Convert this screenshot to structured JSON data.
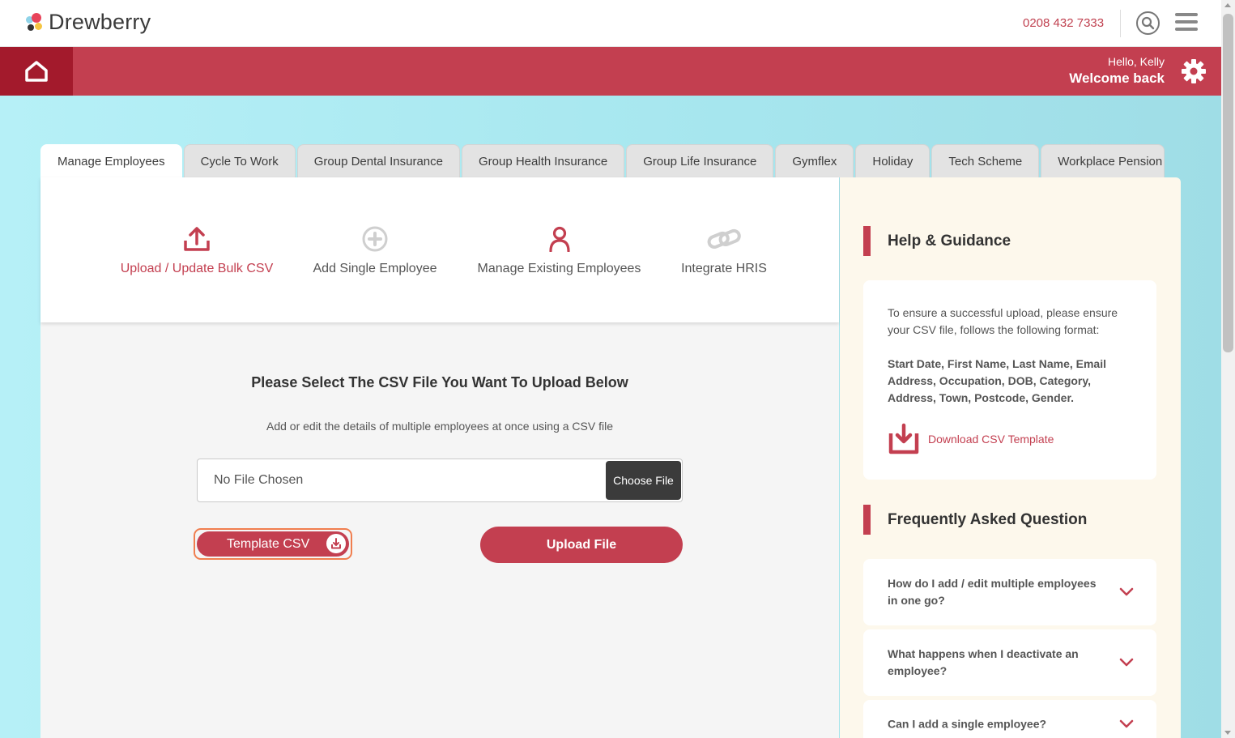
{
  "header": {
    "logo_text": "Drewberry",
    "phone": "0208 432 7333"
  },
  "welcome": {
    "hello": "Hello, Kelly",
    "welcome_back": "Welcome back"
  },
  "tabs": [
    {
      "label": "Manage Employees",
      "active": true
    },
    {
      "label": "Cycle To Work"
    },
    {
      "label": "Group Dental Insurance"
    },
    {
      "label": "Group Health Insurance"
    },
    {
      "label": "Group Life Insurance"
    },
    {
      "label": "Gymflex"
    },
    {
      "label": "Holiday"
    },
    {
      "label": "Tech Scheme"
    },
    {
      "label": "Workplace Pension"
    }
  ],
  "options": [
    {
      "label": "Upload / Update Bulk CSV",
      "icon": "upload-icon",
      "active": true
    },
    {
      "label": "Add Single Employee",
      "icon": "plus-circle-icon"
    },
    {
      "label": "Manage Existing Employees",
      "icon": "person-icon"
    },
    {
      "label": "Integrate HRIS",
      "icon": "link-icon"
    }
  ],
  "upload": {
    "title": "Please Select The CSV File You Want To Upload Below",
    "subtitle": "Add or edit the details of multiple employees at once using a CSV file",
    "file_label": "No File Chosen",
    "choose_button": "Choose File",
    "template_button": "Template CSV",
    "upload_button": "Upload File"
  },
  "help": {
    "title": "Help & Guidance",
    "text": "To ensure a successful upload, please ensure your CSV file, follows the following format:",
    "format": "Start Date, First Name, Last Name, Email Address, Occupation, DOB, Category, Address, Town, Postcode, Gender.",
    "download_label": "Download CSV Template"
  },
  "faq": {
    "title": "Frequently Asked Question",
    "items": [
      "How do I add / edit multiple employees in one go?",
      "What happens when I deactivate an employee?",
      "Can I add a single employee?"
    ]
  },
  "colors": {
    "brand_red": "#c33f50",
    "dark_red": "#a31a2c",
    "accent_orange": "#f07e4f"
  }
}
